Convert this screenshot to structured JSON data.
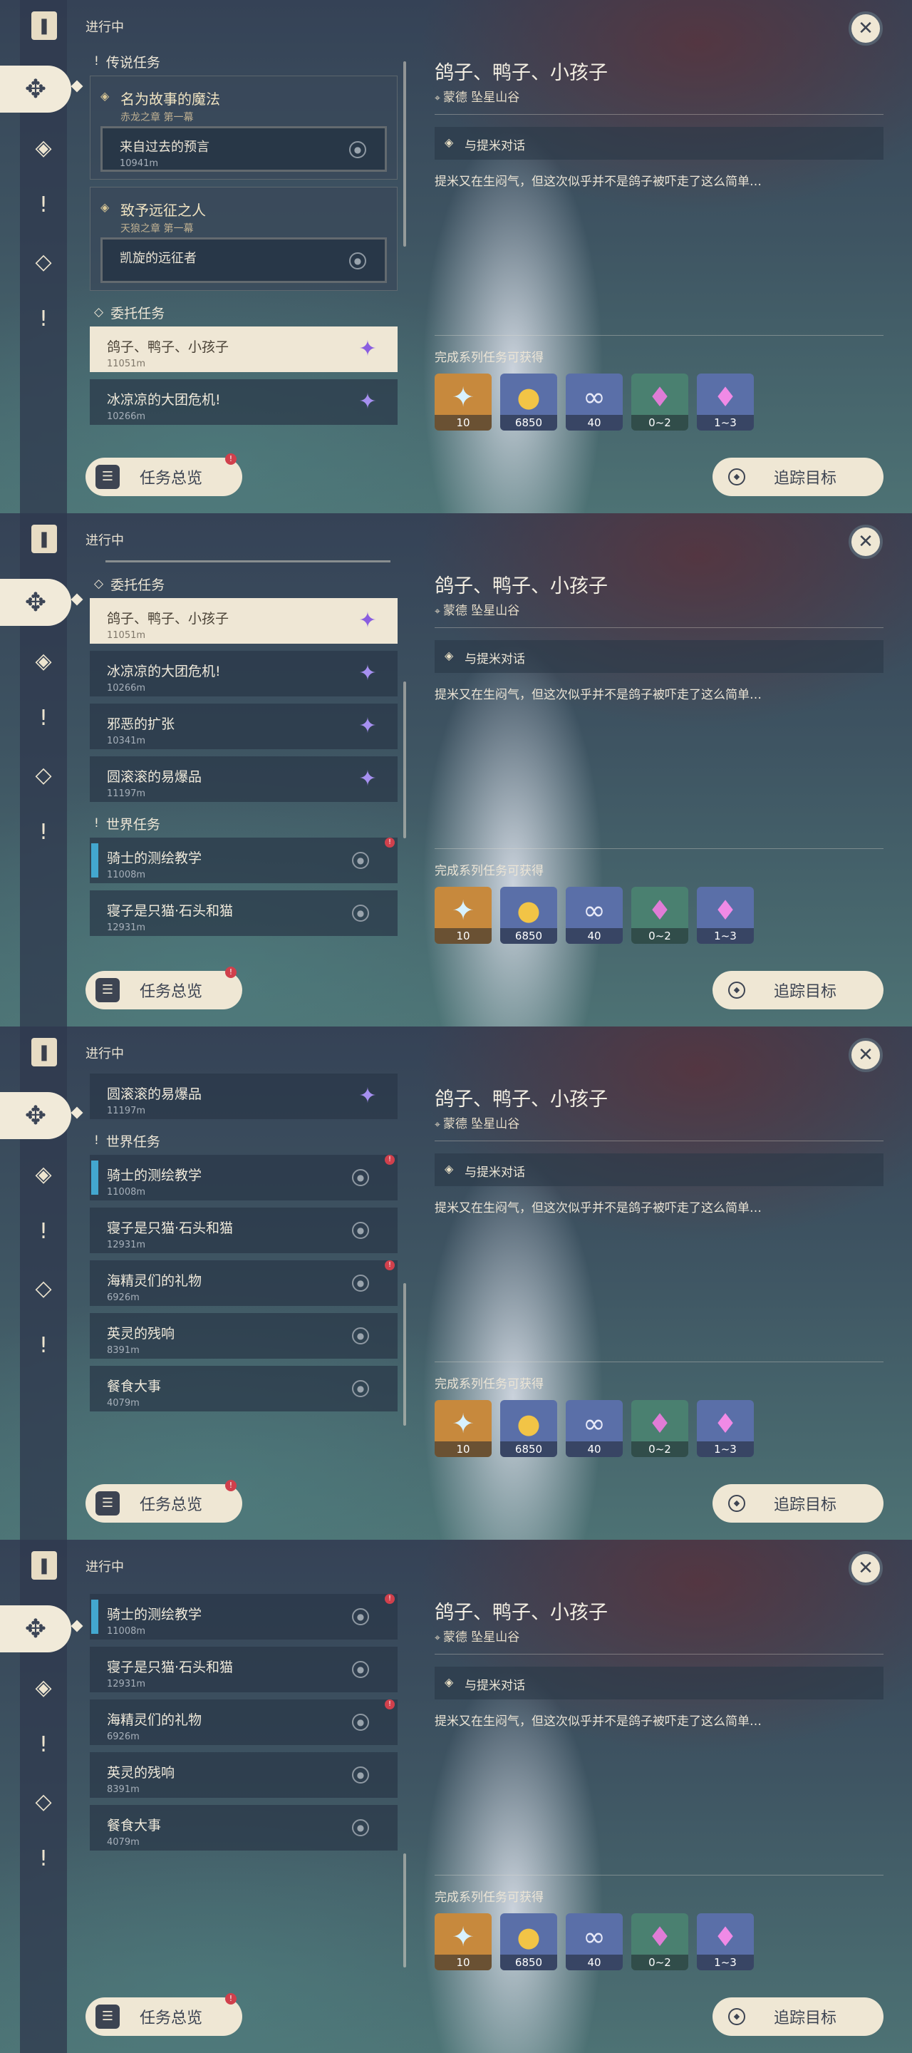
{
  "header": {
    "status": "进行中",
    "close_label": "✕"
  },
  "rail": {
    "items": [
      {
        "icon": "bookmark-icon",
        "glyph": "❚"
      },
      {
        "icon": "all-quests-icon",
        "glyph": "✥"
      },
      {
        "icon": "archon-quest-icon",
        "glyph": "◈"
      },
      {
        "icon": "world-quest-icon",
        "glyph": "!"
      },
      {
        "icon": "commission-icon",
        "glyph": "◇"
      },
      {
        "icon": "event-quest-icon",
        "glyph": "!"
      }
    ]
  },
  "sections": {
    "legend": "传说任务",
    "commission": "委托任务",
    "world": "世界任务"
  },
  "legend_quests": [
    {
      "title": "名为故事的魔法",
      "subtitle": "赤龙之章 第一幕",
      "sub_title": "来自过去的预言",
      "sub_distance": "10941m"
    },
    {
      "title": "致予远征之人",
      "subtitle": "天狼之章 第一幕",
      "sub_title": "凯旋的远征者",
      "sub_distance": ""
    }
  ],
  "commissions": [
    {
      "title": "鸽子、鸭子、小孩子",
      "distance": "11051m",
      "alert": ""
    },
    {
      "title": "冰凉凉的大团危机!",
      "distance": "10266m",
      "alert": "!"
    },
    {
      "title": "邪恶的扩张",
      "distance": "10341m",
      "alert": ""
    },
    {
      "title": "圆滚滚的易爆品",
      "distance": "11197m",
      "alert": ""
    }
  ],
  "world_quests": [
    {
      "title": "骑士的测绘教学",
      "distance": "11008m",
      "alert": "!"
    },
    {
      "title": "寝子是只猫·石头和猫",
      "distance": "12931m",
      "alert": ""
    },
    {
      "title": "海精灵们的礼物",
      "distance": "6926m",
      "alert": "!"
    },
    {
      "title": "英灵的残响",
      "distance": "8391m",
      "alert": ""
    },
    {
      "title": "餐食大事",
      "distance": "4079m",
      "alert": ""
    }
  ],
  "detail": {
    "title": "鸽子、鸭子、小孩子",
    "location": "蒙德 坠星山谷",
    "objective": "与提米对话",
    "description": "提米又在生闷气，但这次似乎并不是鸽子被吓走了这么简单…",
    "rewards_label": "完成系列任务可获得",
    "rewards": [
      {
        "icon": "primogem-icon",
        "glyph": "✦",
        "qty": "10",
        "bg": "#c7893d"
      },
      {
        "icon": "mora-icon",
        "glyph": "●",
        "qty": "6850",
        "bg": "#5a6fa8"
      },
      {
        "icon": "companionship-exp-icon",
        "glyph": "∞",
        "qty": "40",
        "bg": "#5a6fa8"
      },
      {
        "icon": "crystal-chunk-icon",
        "glyph": "♦",
        "qty": "0~2",
        "bg": "#4a8070"
      },
      {
        "icon": "crystal-cluster-icon",
        "glyph": "♦",
        "qty": "1~3",
        "bg": "#5a6fa8"
      }
    ]
  },
  "buttons": {
    "overview": "任务总览",
    "track": "追踪目标",
    "overview_badge": "!"
  }
}
